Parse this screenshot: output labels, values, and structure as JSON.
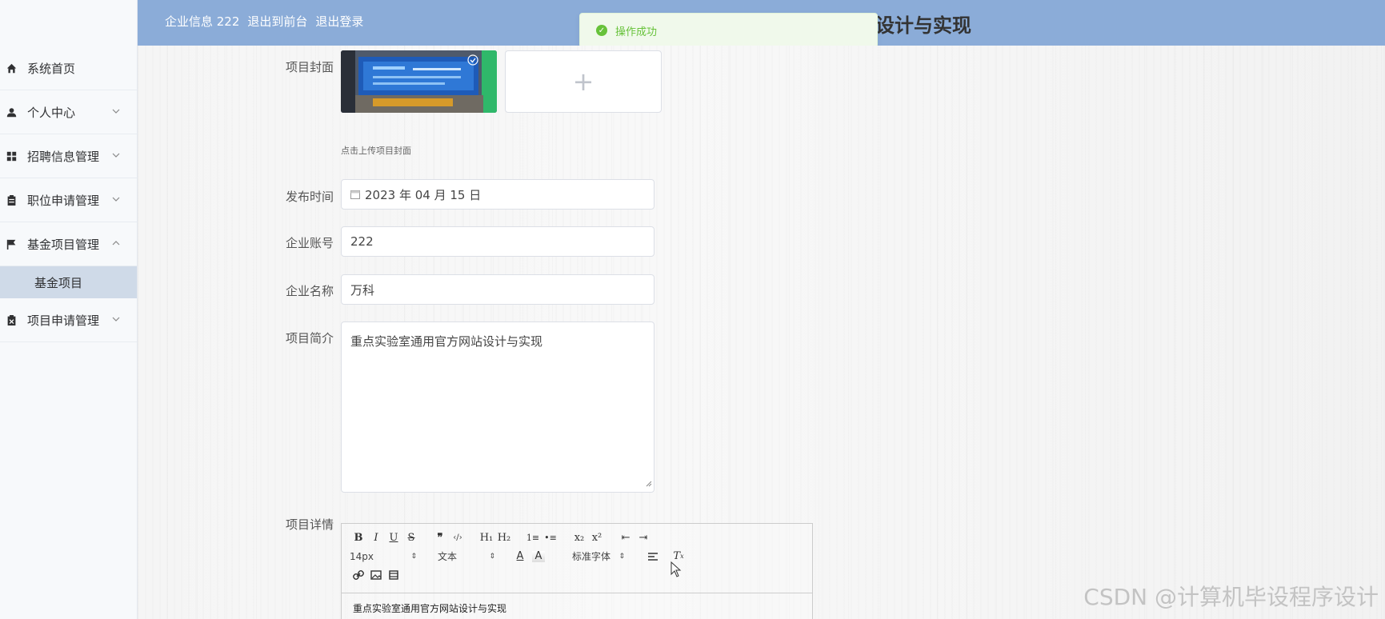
{
  "header": {
    "links": [
      "企业信息 222",
      "退出到前台",
      "退出登录"
    ],
    "title": "设计与实现",
    "color": "#8bacd8"
  },
  "toast": {
    "icon": "check-circle-icon",
    "text": "操作成功",
    "color": "#67c23a"
  },
  "sidebar": {
    "items": [
      {
        "label": "系统首页",
        "icon": "home-icon",
        "expandable": false
      },
      {
        "label": "个人中心",
        "icon": "user-icon",
        "expandable": true
      },
      {
        "label": "招聘信息管理",
        "icon": "grid-icon",
        "expandable": true
      },
      {
        "label": "职位申请管理",
        "icon": "clipboard-icon",
        "expandable": true
      },
      {
        "label": "基金项目管理",
        "icon": "flag-icon",
        "expandable": true,
        "expanded": true
      },
      {
        "label": "项目申请管理",
        "icon": "clipboard-x-icon",
        "expandable": true
      }
    ],
    "submenu": {
      "parent": "基金项目管理",
      "label": "基金项目",
      "active": true
    }
  },
  "form": {
    "cover": {
      "label": "项目封面",
      "tip": "点击上传项目封面",
      "add_symbol": "+"
    },
    "publish_time": {
      "label": "发布时间",
      "value": "2023 年 04 月 15 日"
    },
    "account": {
      "label": "企业账号",
      "value": "222"
    },
    "company": {
      "label": "企业名称",
      "value": "万科"
    },
    "intro": {
      "label": "项目简介",
      "value": "重点实验室通用官方网站设计与实现"
    },
    "detail": {
      "label": "项目详情",
      "toolbar_row1": [
        "B",
        "I",
        "U",
        "S",
        "❞",
        "‹/›",
        "H₁",
        "H₂",
        "1≡",
        "•≡",
        "x₂",
        "x²",
        "⇤",
        "⇥"
      ],
      "font_size": "14px",
      "paragraph": "文本",
      "font_family": "标准字体",
      "content": "重点实验室通用官方网站设计与实现"
    }
  },
  "watermark": "CSDN @计算机毕设程序设计"
}
